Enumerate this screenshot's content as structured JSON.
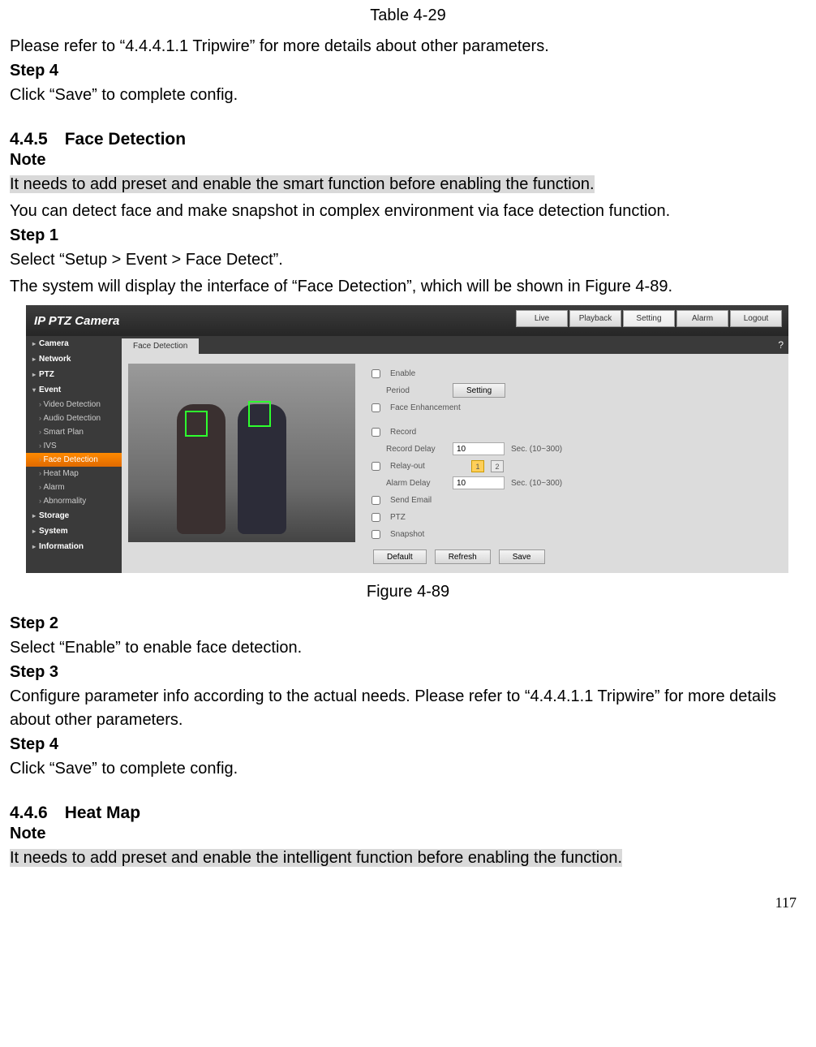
{
  "captions": {
    "table": "Table 4-29",
    "figure": "Figure 4-89"
  },
  "text": {
    "refer_tripwire": "Please refer to “4.4.4.1.1 Tripwire” for more details about other parameters.",
    "step4": "Step 4",
    "save_complete": "Click “Save” to complete config.",
    "sec445": "4.4.5 Face Detection",
    "note": "Note",
    "preset_smart": "It needs to add preset and enable the smart function before enabling the function.",
    "face_detect_desc": "You can detect face and make snapshot in complex environment via face detection function.",
    "step1": "Step 1",
    "select_path": "Select “Setup > Event > Face Detect”.",
    "system_display": "The system will display the interface of “Face Detection”, which will be shown in Figure 4-89.",
    "step2": "Step 2",
    "enable_face": "Select “Enable” to enable face detection.",
    "step3": "Step 3",
    "configure_param": "Configure parameter info according to the actual needs. Please refer to “4.4.4.1.1 Tripwire” for more details about other parameters.",
    "sec446": "4.4.6 Heat Map",
    "preset_intelligent": "It needs to add preset and enable the intelligent function before enabling the function."
  },
  "page_num": "117",
  "screenshot": {
    "title": "IP PTZ Camera",
    "topnav": [
      "Live",
      "Playback",
      "Setting",
      "Alarm",
      "Logout"
    ],
    "topnav_active": "Setting",
    "sidebar": {
      "groups": [
        {
          "label": "Camera",
          "bold": true,
          "type": "expandable"
        },
        {
          "label": "Network",
          "bold": true,
          "type": "expandable"
        },
        {
          "label": "PTZ",
          "bold": true,
          "type": "expandable"
        },
        {
          "label": "Event",
          "bold": true,
          "type": "expanded",
          "children": [
            {
              "label": "Video Detection"
            },
            {
              "label": "Audio Detection"
            },
            {
              "label": "Smart Plan"
            },
            {
              "label": "IVS"
            },
            {
              "label": "Face Detection",
              "active": true
            },
            {
              "label": "Heat Map"
            },
            {
              "label": "Alarm"
            },
            {
              "label": "Abnormality"
            }
          ]
        },
        {
          "label": "Storage",
          "bold": true,
          "type": "expandable"
        },
        {
          "label": "System",
          "bold": true,
          "type": "expandable"
        },
        {
          "label": "Information",
          "bold": true,
          "type": "expandable"
        }
      ]
    },
    "tab": "Face Detection",
    "form": {
      "enable": "Enable",
      "period": "Period",
      "setting_btn": "Setting",
      "face_enh": "Face Enhancement",
      "record": "Record",
      "record_delay": "Record Delay",
      "record_delay_val": "10",
      "sec_range": "Sec. (10~300)",
      "relay_out": "Relay-out",
      "relay_1": "1",
      "relay_2": "2",
      "alarm_delay": "Alarm Delay",
      "alarm_delay_val": "10",
      "send_email": "Send Email",
      "ptz": "PTZ",
      "snapshot": "Snapshot",
      "btn_default": "Default",
      "btn_refresh": "Refresh",
      "btn_save": "Save"
    }
  }
}
